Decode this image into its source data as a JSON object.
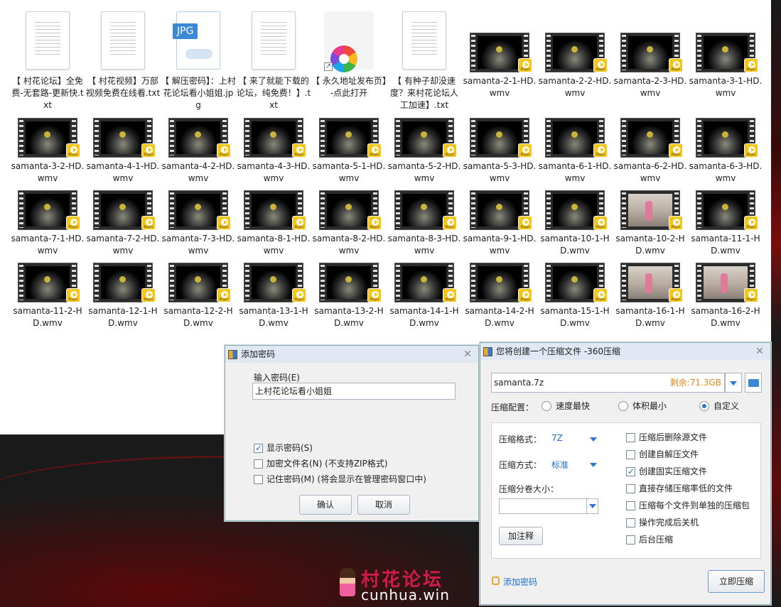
{
  "files": [
    {
      "name": "【 村花论坛】全免费-无套路-更新快.txt",
      "kind": "txt"
    },
    {
      "name": "【 村花视频】万部视频免费在线看.txt",
      "kind": "txt"
    },
    {
      "name": "【 解压密码】：上村花论坛看小姐姐.jpg",
      "kind": "jpg"
    },
    {
      "name": "【 来了就能下载的论坛，纯免费！】.txt",
      "kind": "txt"
    },
    {
      "name": "【 永久地址发布页】-点此打开",
      "kind": "link"
    },
    {
      "name": "【 有种子却没速度？来村花论坛人工加速】.txt",
      "kind": "txt"
    },
    {
      "name": "samanta-2-1-HD.wmv",
      "kind": "video"
    },
    {
      "name": "samanta-2-2-HD.wmv",
      "kind": "video"
    },
    {
      "name": "samanta-2-3-HD.wmv",
      "kind": "video"
    },
    {
      "name": "samanta-3-1-HD.wmv",
      "kind": "video"
    },
    {
      "name": "samanta-3-2-HD.wmv",
      "kind": "video"
    },
    {
      "name": "samanta-4-1-HD.wmv",
      "kind": "video"
    },
    {
      "name": "samanta-4-2-HD.wmv",
      "kind": "video"
    },
    {
      "name": "samanta-4-3-HD.wmv",
      "kind": "video"
    },
    {
      "name": "samanta-5-1-HD.wmv",
      "kind": "video"
    },
    {
      "name": "samanta-5-2-HD.wmv",
      "kind": "video"
    },
    {
      "name": "samanta-5-3-HD.wmv",
      "kind": "video"
    },
    {
      "name": "samanta-6-1-HD.wmv",
      "kind": "video"
    },
    {
      "name": "samanta-6-2-HD.wmv",
      "kind": "video"
    },
    {
      "name": "samanta-6-3-HD.wmv",
      "kind": "video"
    },
    {
      "name": "samanta-7-1-HD.wmv",
      "kind": "video"
    },
    {
      "name": "samanta-7-2-HD.wmv",
      "kind": "video"
    },
    {
      "name": "samanta-7-3-HD.wmv",
      "kind": "video"
    },
    {
      "name": "samanta-8-1-HD.wmv",
      "kind": "video"
    },
    {
      "name": "samanta-8-2-HD.wmv",
      "kind": "video"
    },
    {
      "name": "samanta-8-3-HD.wmv",
      "kind": "video"
    },
    {
      "name": "samanta-9-1-HD.wmv",
      "kind": "video"
    },
    {
      "name": "samanta-10-1-HD.wmv",
      "kind": "video"
    },
    {
      "name": "samanta-10-2-HD.wmv",
      "kind": "video-room"
    },
    {
      "name": "samanta-11-1-HD.wmv",
      "kind": "video"
    },
    {
      "name": "samanta-11-2-HD.wmv",
      "kind": "video"
    },
    {
      "name": "samanta-12-1-HD.wmv",
      "kind": "video"
    },
    {
      "name": "samanta-12-2-HD.wmv",
      "kind": "video"
    },
    {
      "name": "samanta-13-1-HD.wmv",
      "kind": "video"
    },
    {
      "name": "samanta-13-2-HD.wmv",
      "kind": "video"
    },
    {
      "name": "samanta-14-1-HD.wmv",
      "kind": "video"
    },
    {
      "name": "samanta-14-2-HD.wmv",
      "kind": "video"
    },
    {
      "name": "samanta-15-1-HD.wmv",
      "kind": "video"
    },
    {
      "name": "samanta-16-1-HD.wmv",
      "kind": "video-room"
    },
    {
      "name": "samanta-16-2-HD.wmv",
      "kind": "video-room"
    }
  ],
  "player_badge": "Player",
  "jpg_label": "JPG",
  "pwd_dialog": {
    "title": "添加密码",
    "input_label": "输入密码(E)",
    "password_value": "上村花论坛看小姐姐",
    "show_password": "显示密码(S)",
    "encrypt_names": "加密文件名(N) (不支持ZIP格式)",
    "remember": "记住密码(M) (将会显示在管理密码窗口中)",
    "ok": "确认",
    "cancel": "取消"
  },
  "zip_dialog": {
    "title": "您将创建一个压缩文件 -360压缩",
    "filename": "samanta.7z",
    "free_space": "剩余:71.3GB",
    "config_label": "压缩配置：",
    "opt_fast": "速度最快",
    "opt_small": "体积最小",
    "opt_custom": "自定义",
    "format_label": "压缩格式：",
    "format_value": "7Z",
    "method_label": "压缩方式：",
    "method_value": "标准",
    "split_label": "压缩分卷大小：",
    "comment_btn": "加注释",
    "checks": [
      {
        "label": "压缩后删除源文件",
        "checked": false
      },
      {
        "label": "创建自解压文件",
        "checked": false
      },
      {
        "label": "创建固实压缩文件",
        "checked": true
      },
      {
        "label": "直接存储压缩率低的文件",
        "checked": false
      },
      {
        "label": "压缩每个文件到单独的压缩包",
        "checked": false
      },
      {
        "label": "操作完成后关机",
        "checked": false
      },
      {
        "label": "后台压缩",
        "checked": false
      }
    ],
    "add_password": "添加密码",
    "compress_now": "立即压缩"
  },
  "watermark": {
    "cn": "村花论坛",
    "en": "cunhua.win"
  },
  "colors": {
    "accent": "#1f6fd0",
    "free_space": "#e08a1a",
    "logo_red": "#d01a4a"
  }
}
